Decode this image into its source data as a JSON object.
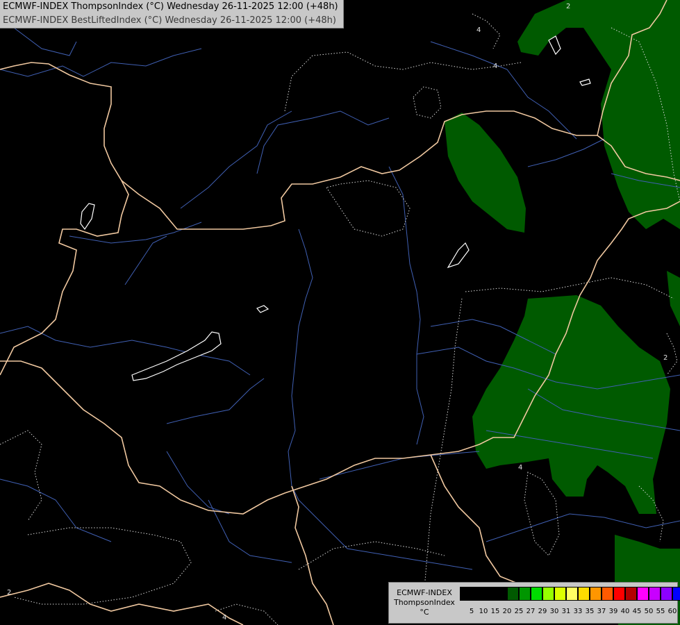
{
  "header": {
    "line1": "ECMWF-INDEX ThompsonIndex (°C) Wednesday 26-11-2025 12:00 (+48h)",
    "line2": "ECMWF-INDEX BestLiftedIndex (°C) Wednesday 26-11-2025 12:00 (+48h)"
  },
  "legend": {
    "model": "ECMWF-INDEX",
    "parameter": "ThompsonIndex",
    "unit": "°C",
    "ticks": [
      "5",
      "10",
      "15",
      "20",
      "25",
      "27",
      "29",
      "30",
      "31",
      "33",
      "35",
      "37",
      "39",
      "40",
      "45",
      "50",
      "55",
      "60"
    ],
    "swatch_colors": [
      "#000000",
      "#000000",
      "#000000",
      "#000000",
      "#005a00",
      "#009600",
      "#00dc00",
      "#96ff00",
      "#dcff00",
      "#ffff64",
      "#ffdc00",
      "#ff9600",
      "#ff5a00",
      "#ff0000",
      "#b40000",
      "#ff00ff",
      "#c800ff",
      "#8c00ff",
      "#0000ff"
    ]
  },
  "map": {
    "contour_labels": [
      "4",
      "4",
      "4",
      "2",
      "2",
      "4",
      "2"
    ],
    "colors": {
      "background": "#000000",
      "border": "#f0c8a0",
      "river": "#4060b4",
      "contour": "#d8d8d8",
      "shade_25": "#005a00"
    }
  }
}
